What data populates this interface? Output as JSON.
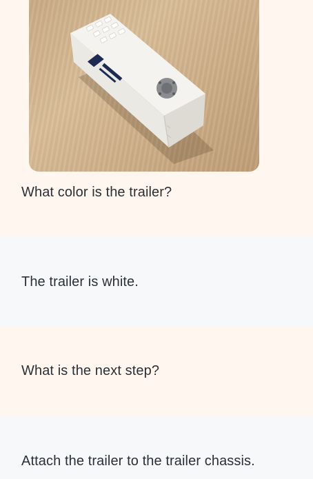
{
  "conversation": {
    "messages": [
      {
        "role": "user",
        "image": {
          "alt": "white 3D-printed trailer box on a wooden surface",
          "colors": {
            "box": "#f3f2ef",
            "wood": "#d2b48f",
            "connector": "#7d7f83",
            "logo": "#1d2a54"
          }
        },
        "text": "What color is the trailer?"
      },
      {
        "role": "assistant",
        "text": "The trailer is white."
      },
      {
        "role": "user",
        "text": "What is the next step?"
      },
      {
        "role": "assistant",
        "text": "Attach the trailer to the trailer chassis."
      }
    ]
  },
  "theme": {
    "user_bg": "#fff6ef",
    "assistant_bg": "#f7f8fa",
    "text_color": "#2b2f36"
  }
}
